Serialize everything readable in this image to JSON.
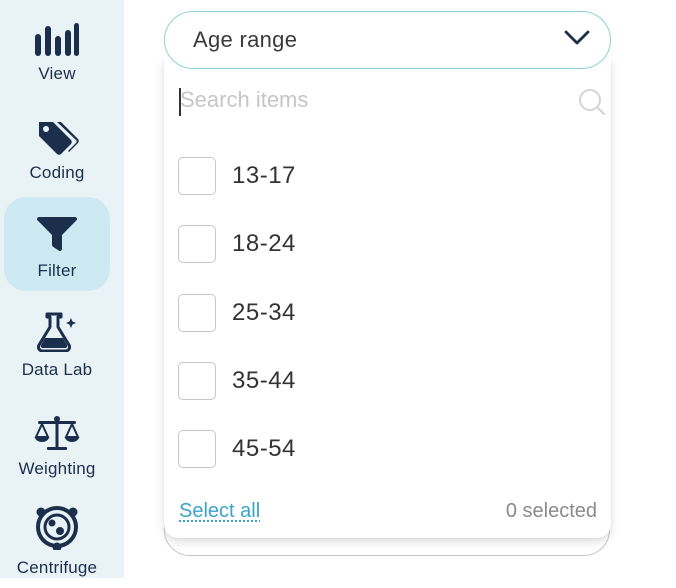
{
  "sidebar": {
    "items": [
      {
        "label": "View",
        "icon": "bar-chart-icon"
      },
      {
        "label": "Coding",
        "icon": "tags-icon"
      },
      {
        "label": "Filter",
        "icon": "funnel-icon",
        "active": true
      },
      {
        "label": "Data Lab",
        "icon": "flask-icon"
      },
      {
        "label": "Weighting",
        "icon": "scales-icon"
      },
      {
        "label": "Centrifuge",
        "icon": "centrifuge-icon"
      }
    ]
  },
  "filter_select": {
    "title": "Age range",
    "search_placeholder": "Search items",
    "options": [
      {
        "label": "13-17",
        "checked": false
      },
      {
        "label": "18-24",
        "checked": false
      },
      {
        "label": "25-34",
        "checked": false
      },
      {
        "label": "35-44",
        "checked": false
      },
      {
        "label": "45-54",
        "checked": false
      }
    ],
    "select_all_label": "Select all",
    "selected_count": "0 selected"
  },
  "colors": {
    "sidebar_bg": "#e9f3f5",
    "active_bg": "#cdeaf3",
    "icon_color": "#1b2f4d",
    "accent": "#3aa3c8",
    "header_border": "#8fd0d8"
  }
}
